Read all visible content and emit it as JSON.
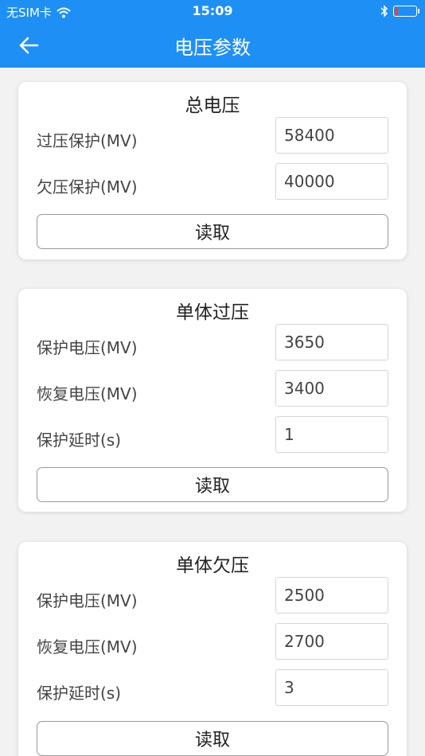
{
  "status_bar": {
    "carrier": "无SIM卡",
    "time": "15:09"
  },
  "header": {
    "title": "电压参数"
  },
  "colors": {
    "accent": "#1e8ff5",
    "battery_low": "#ff3b30"
  },
  "icons": {
    "back": "arrow-left-icon",
    "wifi": "wifi-icon",
    "bluetooth": "bluetooth-icon",
    "battery": "battery-low-icon"
  },
  "battery_level_percent": 15,
  "sections": [
    {
      "title": "总电压",
      "rows": [
        {
          "label": "过压保护(MV)",
          "value": "58400"
        },
        {
          "label": "欠压保护(MV)",
          "value": "40000"
        }
      ],
      "button_label": "读取"
    },
    {
      "title": "单体过压",
      "rows": [
        {
          "label": "保护电压(MV)",
          "value": "3650"
        },
        {
          "label": "恢复电压(MV)",
          "value": "3400"
        },
        {
          "label": "保护延时(s)",
          "value": "1"
        }
      ],
      "button_label": "读取"
    },
    {
      "title": "单体欠压",
      "rows": [
        {
          "label": "保护电压(MV)",
          "value": "2500"
        },
        {
          "label": "恢复电压(MV)",
          "value": "2700"
        },
        {
          "label": "保护延时(s)",
          "value": "3"
        }
      ],
      "button_label": "读取"
    }
  ]
}
